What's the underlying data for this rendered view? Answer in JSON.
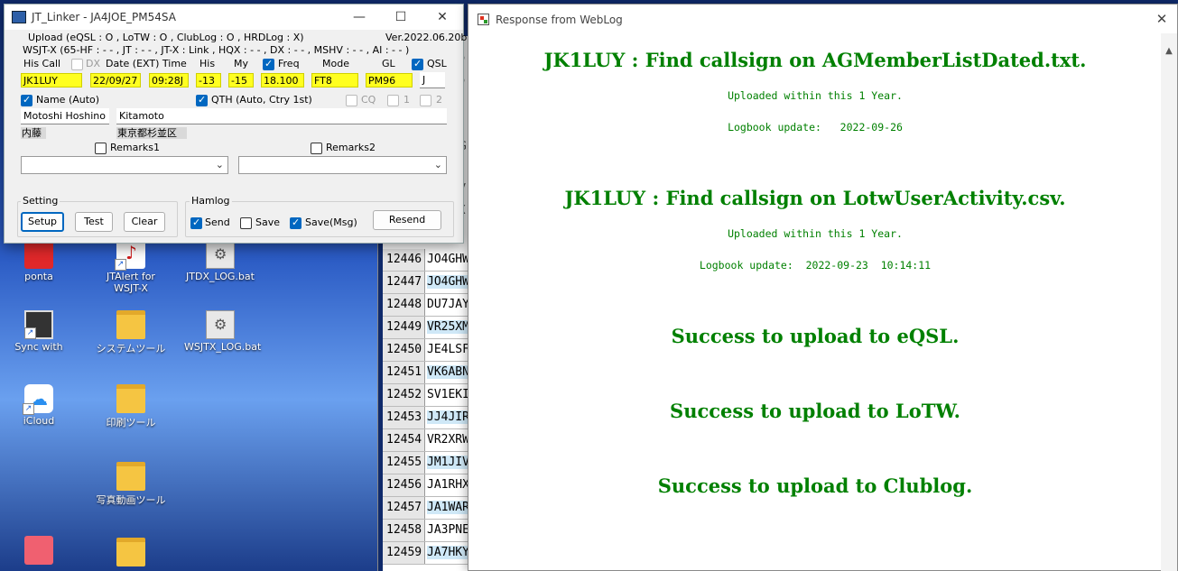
{
  "desktop": {
    "icons": [
      {
        "label": "ponta"
      },
      {
        "label": "JTAlert for WSJT-X"
      },
      {
        "label": "JTDX_LOG.bat"
      },
      {
        "label": "Sync with"
      },
      {
        "label": "システムツール"
      },
      {
        "label": "WSJTX_LOG.bat"
      },
      {
        "label": "iCloud"
      },
      {
        "label": "印刷ツール"
      },
      {
        "label": "写真動画ツール"
      }
    ]
  },
  "sheet": {
    "rows": [
      {
        "num": "12446",
        "call": "JO4GHW"
      },
      {
        "num": "12447",
        "call": "JO4GHW"
      },
      {
        "num": "12448",
        "call": "DU7JAY"
      },
      {
        "num": "12449",
        "call": "VR25XM"
      },
      {
        "num": "12450",
        "call": "JE4LSF"
      },
      {
        "num": "12451",
        "call": "VK6ABN"
      },
      {
        "num": "12452",
        "call": "SV1EKI"
      },
      {
        "num": "12453",
        "call": "JJ4JIR"
      },
      {
        "num": "12454",
        "call": "VR2XRW"
      },
      {
        "num": "12455",
        "call": "JM1JIV"
      },
      {
        "num": "12456",
        "call": "JA1RHX"
      },
      {
        "num": "12457",
        "call": "JA1WAR"
      },
      {
        "num": "12458",
        "call": "JA3PNE"
      },
      {
        "num": "12459",
        "call": "JA7HKY"
      }
    ],
    "top_letters": [
      "P",
      "P",
      "F",
      "G",
      "F",
      "V",
      "X"
    ]
  },
  "jt_linker": {
    "title": "JT_Linker - JA4JOE_PM54SA",
    "upload_line": "Upload (eQSL : O , LoTW : O , ClubLog : O , HRDLog : X)",
    "version": "Ver.2022.06.20b",
    "wsjt_line": "WSJT-X (65-HF : - - , JT : - - , JT-X : Link , HQX : - - , DX : - - , MSHV : - - , AI : - - )",
    "labels": {
      "his_call": "His Call",
      "dx": "DX",
      "date_time": "Date (EXT) Time",
      "his": "His",
      "my": "My",
      "freq": "Freq",
      "mode": "Mode",
      "gl": "GL",
      "qsl": "QSL",
      "name": "Name (Auto)",
      "qth": "QTH (Auto, Ctry 1st)",
      "cq": "CQ",
      "one": "1",
      "two": "2",
      "remarks1": "Remarks1",
      "remarks2": "Remarks2"
    },
    "fields": {
      "callsign": "JK1LUY",
      "date": "22/09/27",
      "time": "09:28J",
      "his_rst": "-13",
      "my_rst": "-15",
      "freq": "18.100",
      "mode": "FT8",
      "grid": "PM96",
      "qsl": "J",
      "name": "Motoshi Hoshino",
      "qth": "Kitamoto",
      "name_note": "内藤",
      "qth_note": "東京都杉並区",
      "remarks1": "",
      "remarks2": ""
    },
    "setting": {
      "legend": "Setting",
      "setup": "Setup",
      "test": "Test",
      "clear": "Clear"
    },
    "hamlog": {
      "legend": "Hamlog",
      "send": "Send",
      "save": "Save",
      "save_msg": "Save(Msg)",
      "resend": "Resend"
    }
  },
  "weblog": {
    "title": "Response from WebLog",
    "sections": [
      {
        "heading": "JK1LUY : Find callsign on AGMemberListDated.txt.",
        "line1": "Uploaded within this 1 Year.",
        "line2": "Logbook update:   2022-09-26"
      },
      {
        "heading": "JK1LUY : Find callsign on LotwUserActivity.csv.",
        "line1": "Uploaded within this 1 Year.",
        "line2": "Logbook update:  2022-09-23  10:14:11"
      }
    ],
    "results": [
      "Success to upload to eQSL.",
      "Success to upload to LoTW.",
      "Success to upload to Clublog."
    ]
  }
}
